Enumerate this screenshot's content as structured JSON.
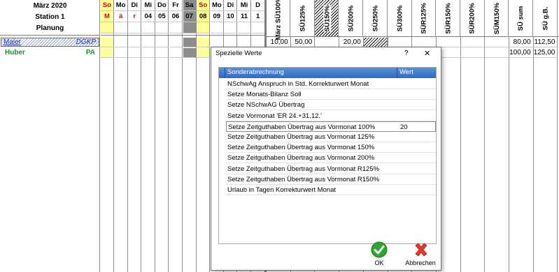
{
  "header": {
    "month": "März 2020",
    "station": "Station 1",
    "plan": "Planung"
  },
  "days": [
    {
      "dow": "So",
      "num": "M",
      "weekend": "yellow",
      "red": true
    },
    {
      "dow": "Mo",
      "num": "ä",
      "weekend": "",
      "red": true
    },
    {
      "dow": "Di",
      "num": "r",
      "weekend": "",
      "red": true
    },
    {
      "dow": "Mi",
      "num": "04",
      "weekend": "",
      "red": false
    },
    {
      "dow": "Do",
      "num": "05",
      "weekend": "",
      "red": false
    },
    {
      "dow": "Fr",
      "num": "06",
      "weekend": "",
      "red": false
    },
    {
      "dow": "Sa",
      "num": "07",
      "weekend": "grey",
      "red": false
    },
    {
      "dow": "So",
      "num": "08",
      "weekend": "yellow",
      "red": false
    },
    {
      "dow": "Mo",
      "num": "09",
      "weekend": "",
      "red": false
    },
    {
      "dow": "Di",
      "num": "10",
      "weekend": "",
      "red": false
    },
    {
      "dow": "Mi",
      "num": "11",
      "weekend": "",
      "red": false
    },
    {
      "dow": "D",
      "num": "1",
      "weekend": "",
      "red": false
    }
  ],
  "columns": [
    "März\nSÜ100%",
    "SÜ125%",
    "SÜ150%",
    "SÜ200%",
    "SÜ250%",
    "SÜ300%",
    "SÜR125%",
    "SÜR150%",
    "SÜR200%",
    "SÜM150%",
    "SÜ sum",
    "SÜ g.B."
  ],
  "employees": [
    {
      "name": "Maier",
      "role": "DGKP",
      "values": [
        "10,00",
        "50,00",
        "",
        "20,00",
        "",
        "",
        "",
        "",
        "",
        "",
        "80,00",
        "112,50"
      ]
    },
    {
      "name": "Huber",
      "role": "PA",
      "values": [
        "",
        "",
        "",
        "",
        "",
        "",
        "",
        "",
        "",
        "",
        "100,00",
        "125,00"
      ]
    }
  ],
  "dialog": {
    "title": "Spezielle Werte",
    "help": "?",
    "close": "✕",
    "col_name": "Sonderabrechnung",
    "col_value": "Wert",
    "rows": [
      {
        "name": "NSchwAg Anspruch in Std. Korrekturwert Monat",
        "value": ""
      },
      {
        "name": "Setze Monats-Bilanz Soll",
        "value": ""
      },
      {
        "name": "Setze NSchwAG Übertrag",
        "value": ""
      },
      {
        "name": "Setze Vormonat 'ER 24.+31.12.'",
        "value": ""
      },
      {
        "name": "Setze Zeitguthaben Übertrag aus Vormonat 100%",
        "value": "20"
      },
      {
        "name": "Setze Zeitguthaben Übertrag aus Vormonat 125%",
        "value": ""
      },
      {
        "name": "Setze Zeitguthaben Übertrag aus Vormonat 150%",
        "value": ""
      },
      {
        "name": "Setze Zeitguthaben Übertrag aus Vormonat 200%",
        "value": ""
      },
      {
        "name": "Setze Zeitguthaben Übertrag aus Vormonat R125%",
        "value": ""
      },
      {
        "name": "Setze Zeitguthaben Übertrag aus Vormonat R150%",
        "value": ""
      },
      {
        "name": "Urlaub in Tagen Korrekturwert Monat",
        "value": ""
      }
    ],
    "ok_label": "OK",
    "cancel_label": "Abbrechen",
    "ok_color": "#2fa52f",
    "cancel_color": "#e23b2a"
  }
}
